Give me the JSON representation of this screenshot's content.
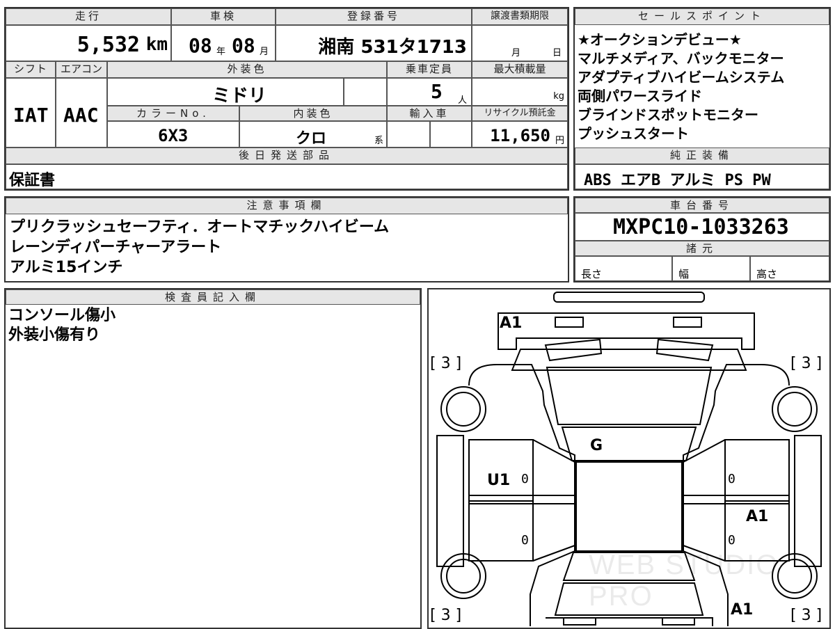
{
  "top": {
    "headers": {
      "mileage": "走行",
      "inspection": "車検",
      "registration": "登録番号",
      "transfer_deadline": "譲渡書類期限",
      "shift": "シフト",
      "aircon": "エアコン",
      "exterior_color": "外装色",
      "capacity": "乗車定員",
      "max_load": "最大積載量",
      "color_no": "カラーNo.",
      "interior_color": "内装色",
      "import": "輸入車",
      "recycle": "リサイクル預託金",
      "later_parts": "後日発送部品"
    },
    "mileage_value": "5,532",
    "mileage_unit": "km",
    "inspection_year": "08",
    "inspection_year_unit": "年",
    "inspection_month": "08",
    "inspection_month_unit": "月",
    "registration_value": "湘南 531タ1713",
    "deadline_month_unit": "月",
    "deadline_day_unit": "日",
    "shift_value": "IAT",
    "aircon_value": "AAC",
    "exterior_color_value": "ミドリ",
    "capacity_value": "5",
    "capacity_unit": "人",
    "max_load_unit": "kg",
    "color_no_value": "6X3",
    "interior_color_value": "クロ",
    "interior_color_suffix": "系",
    "recycle_value": "11,650",
    "recycle_unit": "円",
    "later_parts_value": "保証書"
  },
  "sales": {
    "header": "セールスポイント",
    "lines": [
      "★オークションデビュー★",
      "マルチメディア、バックモニター",
      "アダプティブハイビームシステム",
      "両側パワースライド",
      "ブラインドスポットモニター",
      "プッシュスタート"
    ],
    "equipment_header": "純正装備",
    "equipment_value": "ABS エアB アルミ PS PW"
  },
  "notes": {
    "header": "注意事項欄",
    "lines": [
      "プリクラッシュセーフティ．オートマチックハイビーム",
      "レーンディパーチャーアラート",
      "アルミ15インチ"
    ]
  },
  "chassis": {
    "header": "車台番号",
    "value": "MXPC10-1033263",
    "specs_header": "諸元",
    "length_label": "長さ",
    "width_label": "幅",
    "height_label": "高さ"
  },
  "inspector": {
    "header": "検査員記入欄",
    "lines": [
      "コンソール傷小",
      "外装小傷有り"
    ]
  },
  "diagram": {
    "labels": {
      "front_bumper": "A1",
      "left_front_corner": "[ 3 ]",
      "right_front_corner": "[ 3 ]",
      "windshield": "G",
      "left_front_door": "U1",
      "right_rear_door": "A1",
      "rear_bumper_right": "A1",
      "left_rear_corner": "[ 3 ]",
      "right_rear_corner": "[ 3 ]",
      "zero": "0"
    },
    "watermark": "WEB STUDIO PRO"
  }
}
